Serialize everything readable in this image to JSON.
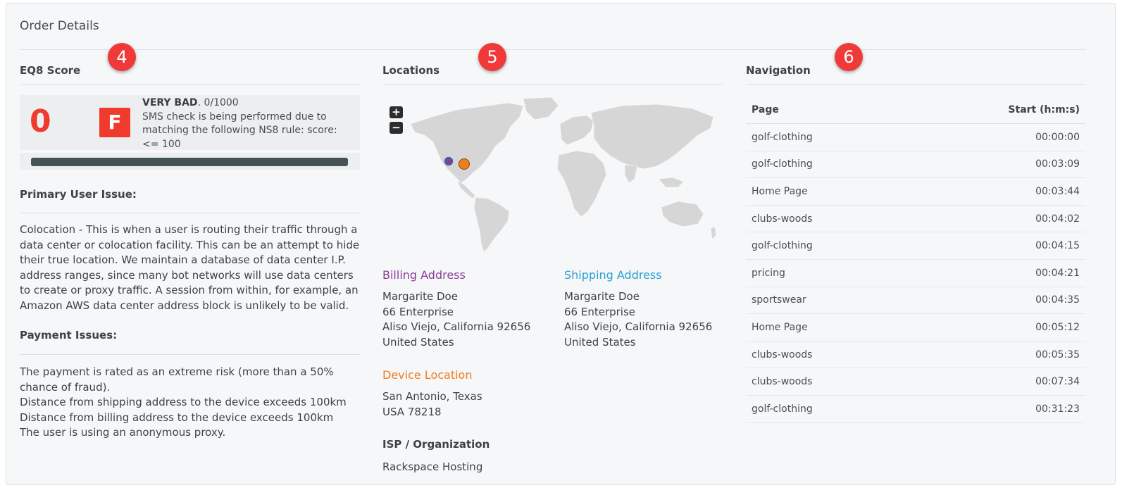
{
  "panel": {
    "title": "Order Details"
  },
  "markers": {
    "score": "4",
    "locations": "5",
    "navigation": "6"
  },
  "score": {
    "section_title": "EQ8 Score",
    "value": "0",
    "grade": "F",
    "rating_label": "VERY BAD",
    "rating_range": ". 0/1000",
    "description": "SMS check is being performed due to matching the following NS8 rule: score: <= 100",
    "bar_fill_fraction": 1.0,
    "primary_issue_title": "Primary User Issue:",
    "primary_issue_text": "Colocation - This is when a user is routing their traffic through a data center or colocation facility. This can be an attempt to hide their true location. We maintain a database of data center I.P. address ranges, since many bot networks will use data centers to create or proxy traffic. A session from within, for example, an Amazon AWS data center address block is unlikely to be valid.",
    "payment_issues_title": "Payment Issues:",
    "payment_issues": [
      "The payment is rated as an extreme risk (more than a 50% chance of fraud).",
      "Distance from shipping address to the device exceeds 100km",
      "Distance from billing address to the device exceeds 100km",
      "The user is using an anonymous proxy."
    ],
    "colors": {
      "score": "#ef3a2d",
      "bar": "#455357"
    }
  },
  "locations": {
    "section_title": "Locations",
    "map": {
      "zoom_in": "+",
      "zoom_out": "−"
    },
    "billing": {
      "title": "Billing Address",
      "color": "#8b3b94",
      "lines": [
        "Margarite Doe",
        "66 Enterprise",
        "Aliso Viejo, California 92656",
        "United States"
      ]
    },
    "shipping": {
      "title": "Shipping Address",
      "color": "#2a9fd6",
      "lines": [
        "Margarite Doe",
        "66 Enterprise",
        "Aliso Viejo, California 92656",
        "United States"
      ]
    },
    "device": {
      "title": "Device Location",
      "color": "#f07d1e",
      "lines": [
        "San Antonio, Texas",
        "USA 78218"
      ]
    },
    "isp": {
      "title": "ISP / Organization",
      "value": "Rackspace Hosting"
    }
  },
  "navigation": {
    "section_title": "Navigation",
    "columns": [
      "Page",
      "Start (h:m:s)"
    ],
    "rows": [
      [
        "golf-clothing",
        "00:00:00"
      ],
      [
        "golf-clothing",
        "00:03:09"
      ],
      [
        "Home Page",
        "00:03:44"
      ],
      [
        "clubs-woods",
        "00:04:02"
      ],
      [
        "golf-clothing",
        "00:04:15"
      ],
      [
        "pricing",
        "00:04:21"
      ],
      [
        "sportswear",
        "00:04:35"
      ],
      [
        "Home Page",
        "00:05:12"
      ],
      [
        "clubs-woods",
        "00:05:35"
      ],
      [
        "clubs-woods",
        "00:07:34"
      ],
      [
        "golf-clothing",
        "00:31:23"
      ]
    ]
  }
}
